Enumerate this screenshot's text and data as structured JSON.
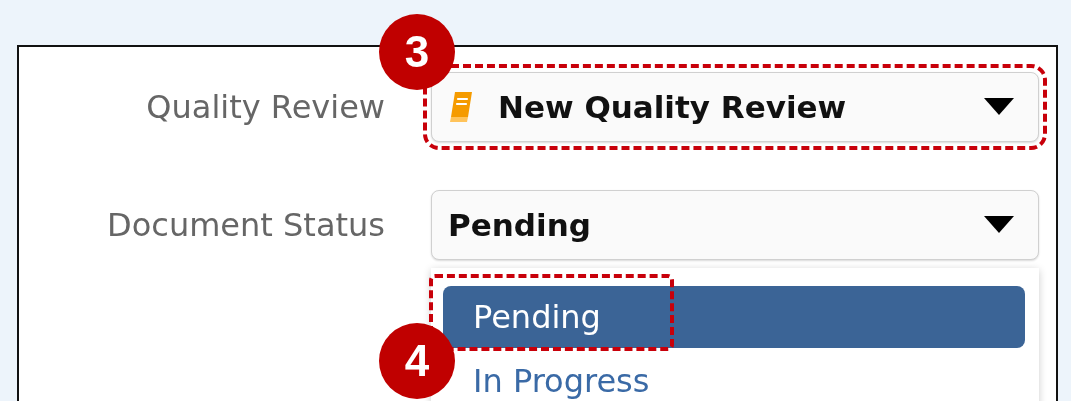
{
  "fields": [
    {
      "label": "Quality Review",
      "value": "New Quality Review",
      "icon": true,
      "callout": "3",
      "highlighted": true
    },
    {
      "label": "Document Status",
      "value": "Pending",
      "highlighted": false,
      "options": [
        {
          "label": "Pending",
          "selected": true,
          "callout": "4",
          "highlighted": true
        },
        {
          "label": "In Progress",
          "selected": false,
          "highlighted": false
        }
      ]
    }
  ]
}
